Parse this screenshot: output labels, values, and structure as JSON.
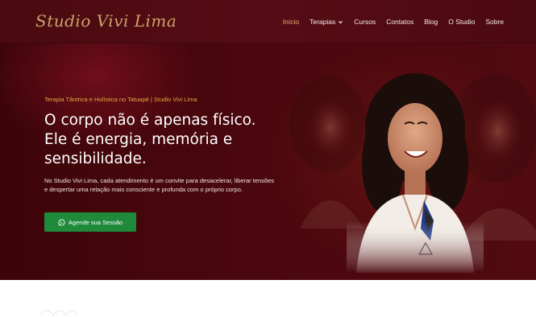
{
  "header": {
    "logo_text": "Studio Vivi Lima",
    "nav": [
      {
        "label": "Início",
        "active": true
      },
      {
        "label": "Terapias",
        "has_dropdown": true
      },
      {
        "label": "Cursos"
      },
      {
        "label": "Contatos"
      },
      {
        "label": "Blog"
      },
      {
        "label": "O Studio"
      },
      {
        "label": "Sobre"
      }
    ]
  },
  "hero": {
    "eyebrow": "Terapia Tântrica e Holística no Tatuapé | Studio Vivi Lima",
    "headline_line1": "O corpo não é apenas físico.",
    "headline_line2": "Ele é energia, memória e",
    "headline_line3": "sensibilidade.",
    "description": "No Studio Vivi Lima, cada atendimento é um convite para desacelerar, liberar tensões e despertar uma relação mais consciente e profunda com o próprio corpo.",
    "cta_label": "Agende sua Sessão",
    "cta_icon": "whatsapp-icon"
  },
  "colors": {
    "header_bg": "#4a0a10",
    "hero_bg": "#3d0509",
    "accent_gold": "#e2a93f",
    "logo_gold": "#c9a56a",
    "cta_green": "#1e8a3a"
  }
}
